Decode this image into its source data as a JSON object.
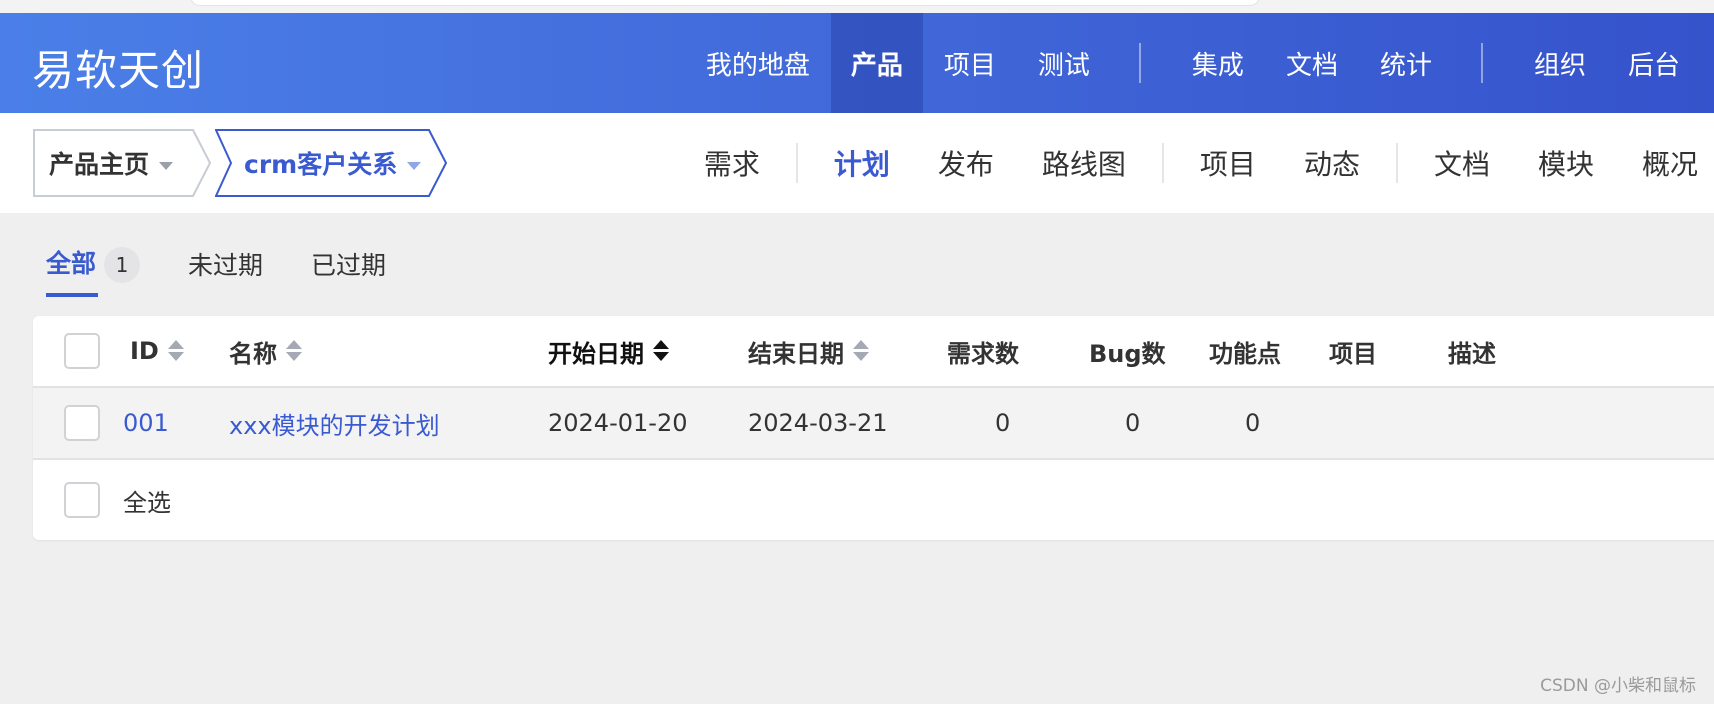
{
  "header": {
    "logo": "易软天创",
    "nav": [
      {
        "label": "我的地盘",
        "active": false
      },
      {
        "label": "产品",
        "active": true
      },
      {
        "label": "项目",
        "active": false
      },
      {
        "label": "测试",
        "active": false
      },
      {
        "label": "集成",
        "active": false
      },
      {
        "label": "文档",
        "active": false
      },
      {
        "label": "统计",
        "active": false
      },
      {
        "label": "组织",
        "active": false
      },
      {
        "label": "后台",
        "active": false
      }
    ]
  },
  "breadcrumb": {
    "home": "产品主页",
    "product": "crm客户关系"
  },
  "subnav": [
    {
      "label": "需求",
      "active": false
    },
    {
      "label": "计划",
      "active": true
    },
    {
      "label": "发布",
      "active": false
    },
    {
      "label": "路线图",
      "active": false
    },
    {
      "label": "项目",
      "active": false
    },
    {
      "label": "动态",
      "active": false
    },
    {
      "label": "文档",
      "active": false
    },
    {
      "label": "模块",
      "active": false
    },
    {
      "label": "概况",
      "active": false
    }
  ],
  "tabs": {
    "all": "全部",
    "all_count": "1",
    "unexpired": "未过期",
    "expired": "已过期"
  },
  "table": {
    "columns": {
      "id": "ID",
      "name": "名称",
      "start": "开始日期",
      "end": "结束日期",
      "stories": "需求数",
      "bugs": "Bug数",
      "points": "功能点",
      "project": "项目",
      "desc": "描述"
    },
    "rows": [
      {
        "id": "001",
        "name": "xxx模块的开发计划",
        "start": "2024-01-20",
        "end": "2024-03-21",
        "stories": "0",
        "bugs": "0",
        "points": "0",
        "project": "",
        "desc": ""
      }
    ],
    "select_all": "全选"
  },
  "watermark": "CSDN @小柴和鼠标",
  "colors": {
    "brand": "#3f64d6",
    "accent": "#3a5bd0"
  }
}
